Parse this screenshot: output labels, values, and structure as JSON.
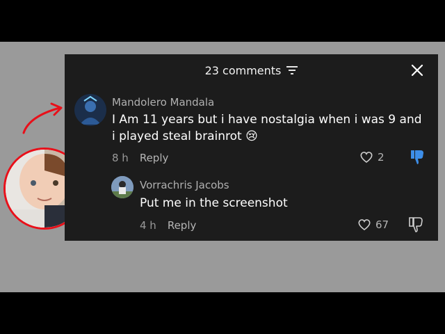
{
  "header": {
    "comment_count": "23 comments"
  },
  "comments": [
    {
      "username": "Mandolero Mandala",
      "text": "I Am 11 years but i have nostalgia when i was 9 and i played steal brainrot 😢",
      "time": "8 h",
      "reply_label": "Reply",
      "likes": "2",
      "disliked": true
    },
    {
      "username": "Vorrachris Jacobs",
      "text": "Put me in the screenshot",
      "time": "4 h",
      "reply_label": "Reply",
      "likes": "67",
      "disliked": false
    }
  ],
  "colors": {
    "accent_blue": "#3d8ee8",
    "annotation_red": "#e8101a"
  }
}
